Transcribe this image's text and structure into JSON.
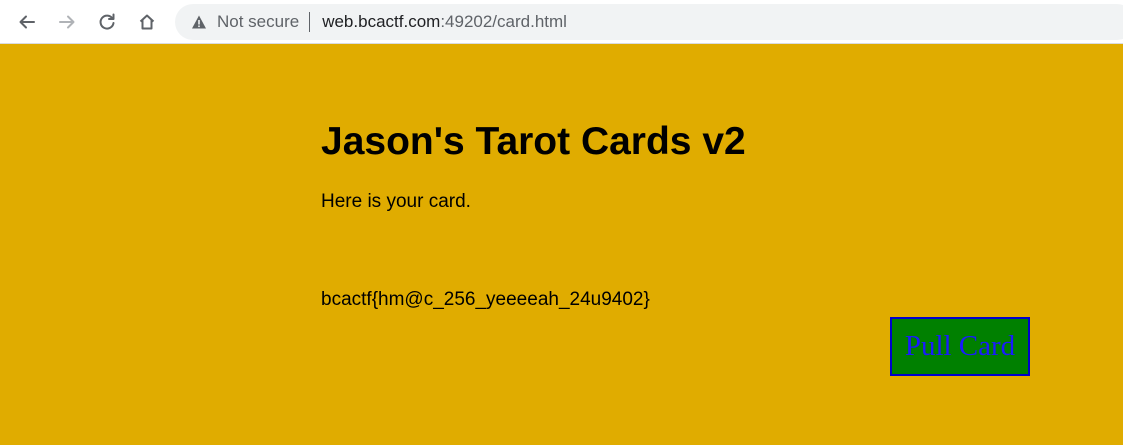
{
  "browser": {
    "security_label": "Not secure",
    "url_host": "web.bcactf.com",
    "url_rest": ":49202/card.html",
    "icons": [
      "back-arrow-icon",
      "forward-arrow-icon",
      "reload-icon",
      "home-icon",
      "warning-triangle-icon"
    ]
  },
  "page": {
    "title": "Jason's Tarot Cards v2",
    "lead": "Here is your card.",
    "card_text": "bcactf{hm@c_256_yeeeeah_24u9402}",
    "button_label": "Pull Card"
  },
  "colors": {
    "page_background": "#e0ac00",
    "button_background": "#008000",
    "button_text": "#1a1aff",
    "button_border": "#0000cc"
  }
}
